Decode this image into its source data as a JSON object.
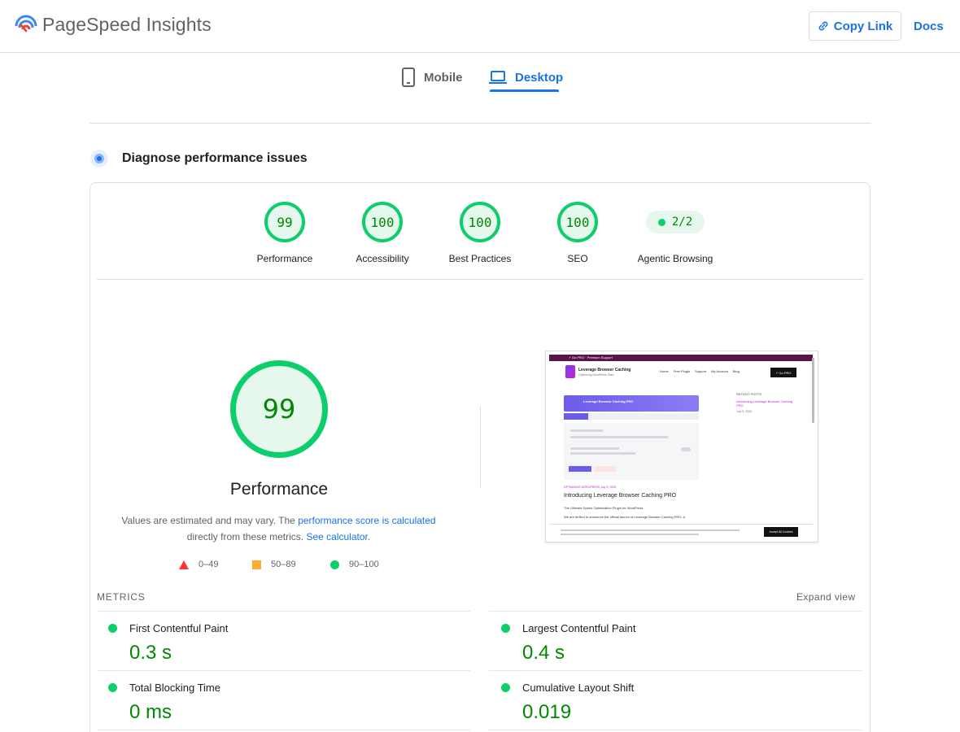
{
  "header": {
    "app_title": "PageSpeed Insights",
    "copy_link_label": "Copy Link",
    "docs_label": "Docs"
  },
  "tabs": [
    {
      "label": "Mobile",
      "icon": "phone-icon",
      "active": false
    },
    {
      "label": "Desktop",
      "icon": "laptop-icon",
      "active": true
    }
  ],
  "section": {
    "title": "Diagnose performance issues",
    "icon": "lighthouse-icon"
  },
  "categories": [
    {
      "label": "Performance",
      "score": "99"
    },
    {
      "label": "Accessibility",
      "score": "100"
    },
    {
      "label": "Best Practices",
      "score": "100"
    },
    {
      "label": "SEO",
      "score": "100"
    },
    {
      "label": "Agentic Browsing",
      "score": "2/2"
    }
  ],
  "performance": {
    "score": "99",
    "label": "Performance",
    "note_prefix": "Values are estimated and may vary. The",
    "note_link1": "performance score is calculated",
    "note_middle": "directly from these metrics.",
    "note_link2": "See calculator",
    "note_suffix": "."
  },
  "legend": [
    {
      "range": "0–49",
      "shape": "triangle",
      "color": "#ff3333"
    },
    {
      "range": "50–89",
      "shape": "square",
      "color": "#ffaa33"
    },
    {
      "range": "90–100",
      "shape": "circle",
      "color": "#0cce6b"
    }
  ],
  "screenshot": {
    "topbar_text": "⚡ Go PRO  ·  Premium Support",
    "site_title": "Leverage Browser Caching",
    "site_subtitle": "Optimizing WordPress Sites",
    "nav_links": [
      "Home",
      "Free Plugin",
      "Support",
      "My Account",
      "Blog"
    ],
    "go_pro_label": "⚡ Go PRO",
    "hero_title": "Leverage Browser Caching PRO",
    "category": "OPTIMIZING WORDPRESS     July 5, 2026",
    "post_title": "Introducing Leverage Browser Caching PRO",
    "post_subtitle": "The Ultimate Speed Optimization Plugin for WordPress",
    "post_text": "We are thrilled to announce the official launch of Leverage Browser Caching PRO, a",
    "recent_posts_label": "RECENT POSTS",
    "recent_post_link": "Introducing Leverage Browser Caching PRO",
    "recent_post_date": "July 5, 2026",
    "accept_label": "Accept All Cookies"
  },
  "metrics": {
    "section_label": "METRICS",
    "expand_label": "Expand view",
    "items": [
      {
        "name": "First Contentful Paint",
        "value": "0.3 s"
      },
      {
        "name": "Largest Contentful Paint",
        "value": "0.4 s"
      },
      {
        "name": "Total Blocking Time",
        "value": "0 ms"
      },
      {
        "name": "Cumulative Layout Shift",
        "value": "0.019"
      }
    ]
  },
  "colors": {
    "accent": "#1a73e8",
    "pass": "#0cce6b",
    "pass_text": "#008800",
    "pass_bg": "#e6f8ee"
  }
}
